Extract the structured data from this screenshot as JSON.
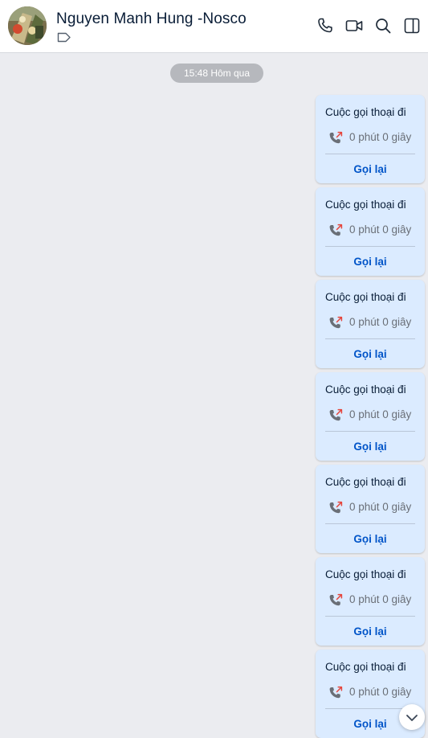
{
  "header": {
    "contact_name": "Nguyen Manh Hung -Nosco",
    "icons": [
      "avatar-photo",
      "tag-icon",
      "phone-icon",
      "video-call-icon",
      "search-icon",
      "sidebar-toggle-icon"
    ]
  },
  "conversation": {
    "time_separator": "15:48 Hôm qua",
    "call_messages": [
      {
        "title": "Cuộc gọi thoại đi",
        "duration": "0 phút 0 giây",
        "action": "Gọi lại"
      },
      {
        "title": "Cuộc gọi thoại đi",
        "duration": "0 phút 0 giây",
        "action": "Gọi lại"
      },
      {
        "title": "Cuộc gọi thoại đi",
        "duration": "0 phút 0 giây",
        "action": "Gọi lại"
      },
      {
        "title": "Cuộc gọi thoại đi",
        "duration": "0 phút 0 giây",
        "action": "Gọi lại"
      },
      {
        "title": "Cuộc gọi thoại đi",
        "duration": "0 phút 0 giây",
        "action": "Gọi lại"
      },
      {
        "title": "Cuộc gọi thoại đi",
        "duration": "0 phút 0 giây",
        "action": "Gọi lại"
      },
      {
        "title": "Cuộc gọi thoại đi",
        "duration": "0 phút 0 giây",
        "action": "Gọi lại"
      }
    ],
    "scroll_down_icon": "chevron-down-icon"
  },
  "colors": {
    "chat_background": "#ebecf0",
    "own_bubble": "#dbebff",
    "link_blue": "#0054c8",
    "outgoing_call_arrow": "#e5453c"
  }
}
